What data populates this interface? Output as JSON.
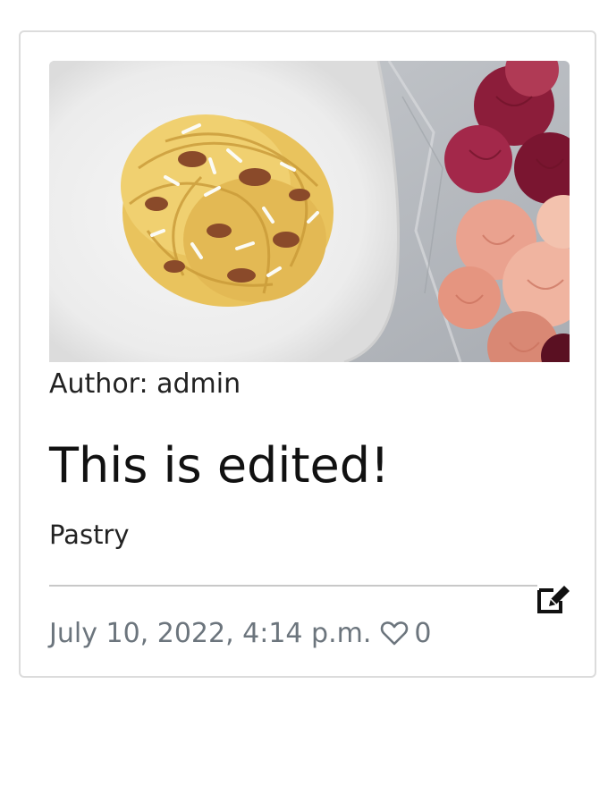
{
  "post": {
    "image_alt": "Plate of pasta with bacon and grated cheese beside pink flowers",
    "author_label": "Author: admin",
    "title": "This is edited!",
    "category": "Pastry",
    "date": "July 10, 2022, 4:14 p.m.",
    "likes": "0"
  },
  "icons": {
    "edit": "edit-icon",
    "like": "heart-outline-icon"
  },
  "colors": {
    "border": "#dcdcdc",
    "muted_text": "#6c757d",
    "divider": "#c8c8c8"
  }
}
